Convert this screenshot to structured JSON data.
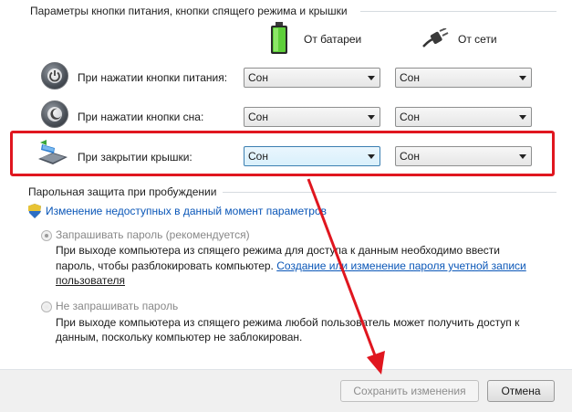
{
  "section_power": {
    "title": "Параметры кнопки питания, кнопки спящего режима и крышки"
  },
  "columns": {
    "battery": "От батареи",
    "plugged": "От сети"
  },
  "rows": [
    {
      "label": "При нажатии кнопки питания:",
      "battery": "Сон",
      "plugged": "Сон"
    },
    {
      "label": "При нажатии кнопки сна:",
      "battery": "Сон",
      "plugged": "Сон"
    },
    {
      "label": "При закрытии крышки:",
      "battery": "Сон",
      "plugged": "Сон"
    }
  ],
  "section_password": {
    "title": "Парольная защита при пробуждении"
  },
  "change_link": "Изменение недоступных в данный момент параметров",
  "option_require": {
    "label": "Запрашивать пароль (рекомендуется)",
    "desc_line1": "При выходе компьютера из спящего режима для доступа к данным необходимо ввести",
    "desc_line2_text": "пароль, чтобы разблокировать компьютер.",
    "desc_link_part1": "Создание или изменение пароля учетной записи",
    "desc_link_part2": "пользователя"
  },
  "option_no_require": {
    "label": "Не запрашивать пароль",
    "desc_line1": "При выходе компьютера из спящего режима любой пользователь может получить доступ к",
    "desc_line2": "данным, поскольку компьютер не заблокирован."
  },
  "buttons": {
    "save": "Сохранить изменения",
    "cancel": "Отмена"
  },
  "colors": {
    "highlight": "#e0161f",
    "link": "#0b57b8",
    "arrow": "#e0161f"
  }
}
